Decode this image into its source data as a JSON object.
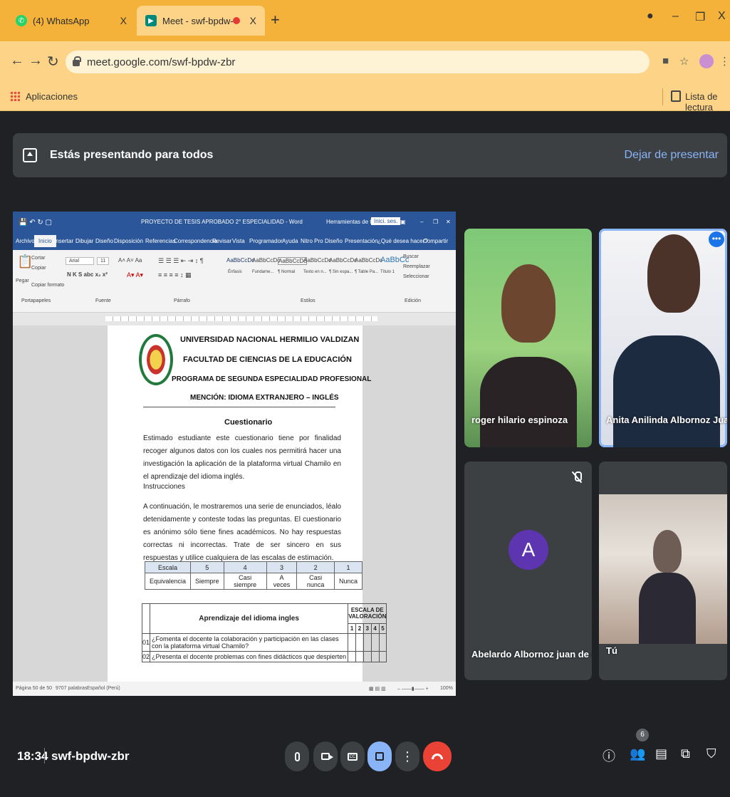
{
  "browser": {
    "tabs": [
      {
        "title": "(4) WhatsApp",
        "close": "X"
      },
      {
        "title": "Meet - swf-bpdw-zbr",
        "close": "X"
      }
    ],
    "new_tab": "+",
    "window_controls": {
      "minimize": "–",
      "restore": "❐",
      "close": "X"
    },
    "url": "meet.google.com/swf-bpdw-zbr",
    "bookmarks": {
      "apps": "Aplicaciones",
      "reading_list": "Lista de lectura"
    }
  },
  "meet": {
    "presenting_text": "Estás presentando para todos",
    "stop_presenting": "Dejar de presentar",
    "time": "18:34",
    "meeting_code": "swf-bpdw-zbr",
    "participant_count": "6",
    "participants": [
      {
        "name": "roger hilario espinoza"
      },
      {
        "name": "Anita Anilinda Albornoz Juan ..."
      },
      {
        "name": "Abelardo Albornoz juan de dios",
        "avatar_letter": "A",
        "muted": true
      },
      {
        "name": "Tú"
      }
    ]
  },
  "word": {
    "title": "PROYECTO DE TESIS APROBADO 2° ESPECIALIDAD - Word",
    "table_tools": "Herramientas de tabla",
    "user": "Inici. ses.",
    "tabs": [
      "Archivo",
      "Inicio",
      "Insertar",
      "Dibujar",
      "Diseño",
      "Disposición",
      "Referencias",
      "Correspondencia",
      "Revisar",
      "Vista",
      "Programador",
      "Ayuda",
      "Nitro Pro",
      "Diseño",
      "Presentación"
    ],
    "tell_me": "¿Qué desea hacer?",
    "share": "Compartir",
    "ribbon": {
      "cut": "Cortar",
      "copy": "Copiar",
      "paste": "Pegar",
      "format_painter": "Copiar formato",
      "font": "Arial",
      "size": "11",
      "styles": [
        "AaBbCcDc",
        "AaBbCcDc",
        "AaBbCcDc",
        "AaBbCcDc",
        "AaBbCcDc",
        "AaBbCcDc",
        "AaBbCc"
      ],
      "style_names": [
        "Énfasis",
        "Fundame...",
        "¶ Normal",
        "Texto en n...",
        "¶ Sin espa...",
        "¶ Table Pa...",
        "Título 1"
      ],
      "find": "Buscar",
      "replace": "Reemplazar",
      "select": "Seleccionar",
      "groups": [
        "Portapapeles",
        "Fuente",
        "Párrafo",
        "Estilos",
        "Edición"
      ]
    },
    "status": {
      "page": "Página 50 de 50",
      "words": "9707 palabras",
      "lang": "Español (Perú)",
      "zoom": "100%"
    },
    "doc": {
      "university": "UNIVERSIDAD NACIONAL HERMILIO VALDIZAN",
      "faculty": "FACULTAD DE CIENCIAS DE LA EDUCACIÓN",
      "program": "PROGRAMA DE SEGUNDA ESPECIALIDAD PROFESIONAL",
      "mention": "MENCIÓN: IDIOMA EXTRANJERO – INGLÉS",
      "heading": "Cuestionario",
      "intro": "Estimado estudiante este cuestionario tiene por finalidad recoger algunos datos con los cuales nos permitirá hacer una investigación la aplicación de la plataforma virtual Chamilo en el aprendizaje del idioma inglés.",
      "instructions_label": "Instrucciones",
      "instructions": "A continuación, le mostraremos una serie de enunciados, léalo detenidamente y conteste todas las preguntas. El cuestionario es anónimo sólo tiene fines académicos. No hay respuestas correctas ni incorrectas. Trate de ser sincero en sus respuestas y utilice cualquiera de las escalas de estimación.",
      "scale_header": [
        "Escala",
        "5",
        "4",
        "3",
        "2",
        "1"
      ],
      "scale_values": [
        "Equivalencia",
        "Siempre",
        "Casi siempre",
        "A veces",
        "Casi nunca",
        "Nunca"
      ],
      "table_title": "Aprendizaje del idioma ingles",
      "valuation_header": "ESCALA DE VALORACIÓN",
      "valuation_cols": [
        "1",
        "2",
        "3",
        "4",
        "5"
      ],
      "rows": [
        {
          "num": "01",
          "text": "¿Fomenta el docente la colaboración y participación en las clases con la plataforma virtual Chamilo?"
        },
        {
          "num": "02",
          "text": "¿Presenta el docente problemas con fines didácticos que despierten"
        }
      ]
    }
  }
}
